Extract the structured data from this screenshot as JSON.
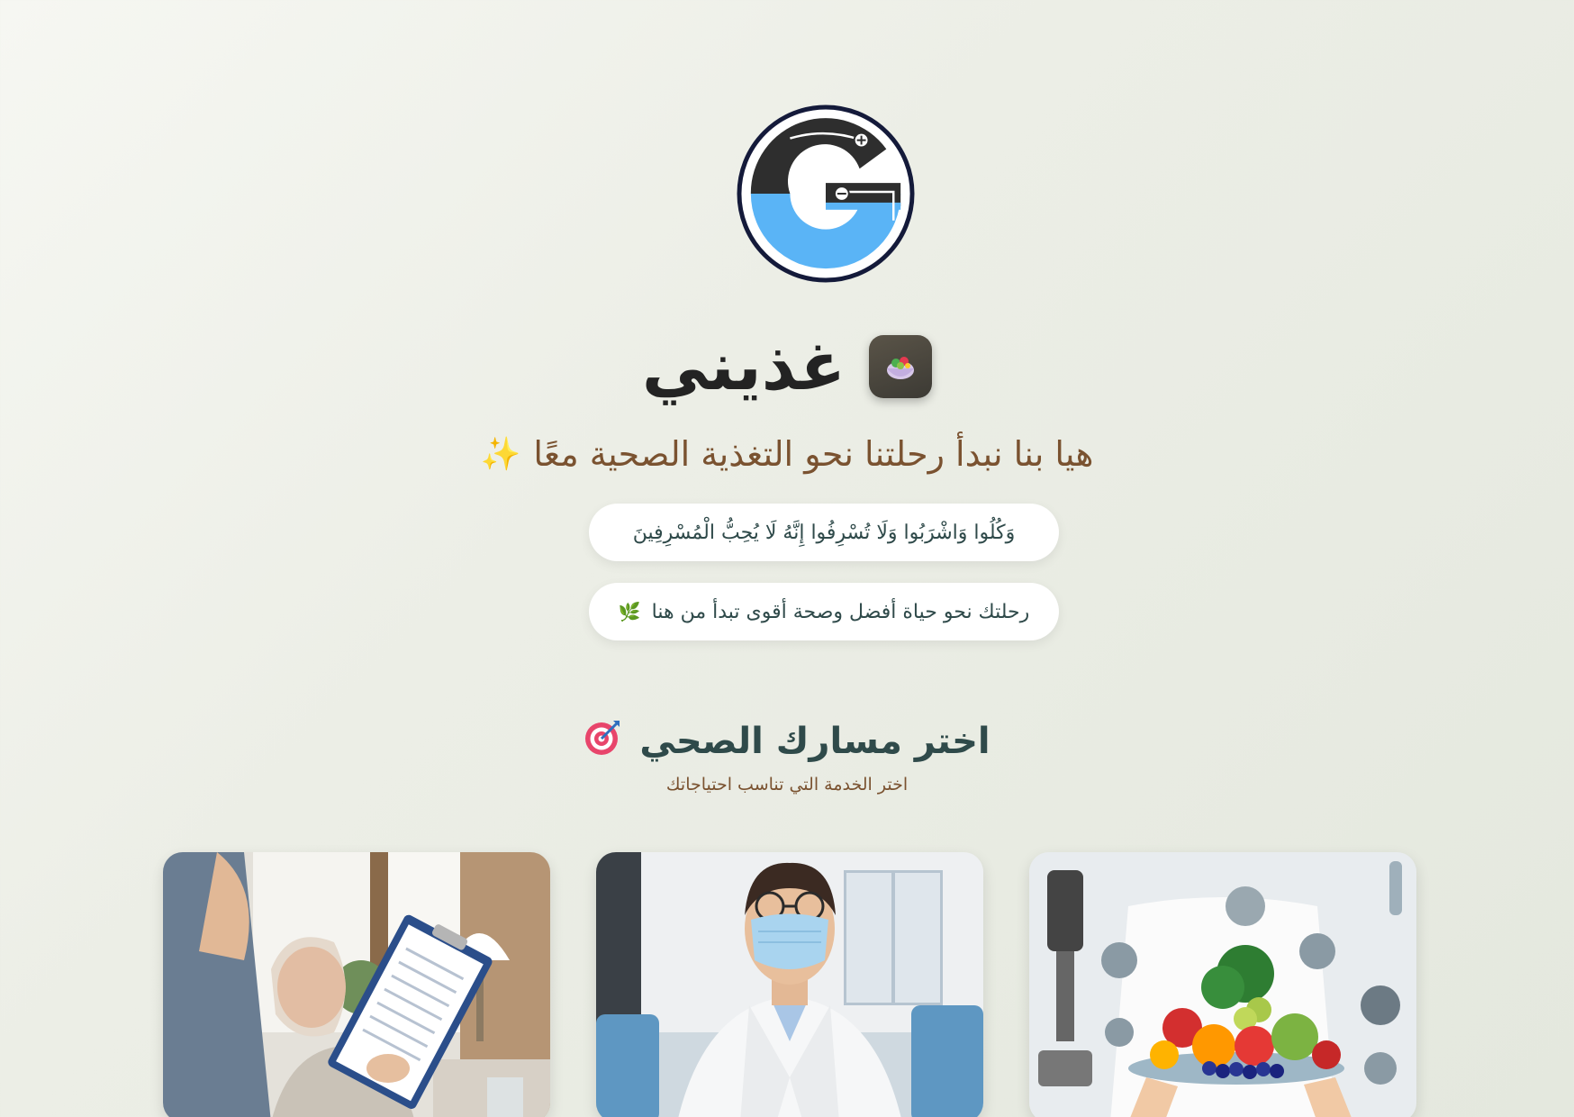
{
  "brand": {
    "name": "غذيني",
    "badge_icon": "salad-bowl-icon",
    "logo_icon": "g-battery-logo-icon",
    "logo_colors": {
      "dark": "#2e2e2e",
      "blue": "#5ab4f6",
      "ring": "#141a3a"
    }
  },
  "tagline": {
    "text": "هيا بنا نبدأ رحلتنا نحو التغذية الصحية معًا",
    "icon": "sparkles-icon"
  },
  "verse": "وَكُلُوا وَاشْرَبُوا وَلَا تُسْرِفُوا إِنَّهُ لَا يُحِبُّ الْمُسْرِفِينَ",
  "journey": {
    "text": "رحلتك نحو حياة أفضل وصحة أقوى تبدأ من هنا",
    "icon": "herb-icon"
  },
  "section": {
    "title": "اختر مسارك الصحي",
    "title_icon": "target-icon",
    "subtitle": "اختر الخدمة التي تناسب احتياجاتك"
  },
  "cards": [
    {
      "image": "caregiver-with-elderly-clipboard-photo"
    },
    {
      "image": "masked-doctor-portrait-photo"
    },
    {
      "image": "lab-fruit-platter-photo"
    }
  ],
  "colors": {
    "accent_brown": "#7a5230",
    "text_teal": "#2f4a4a"
  }
}
